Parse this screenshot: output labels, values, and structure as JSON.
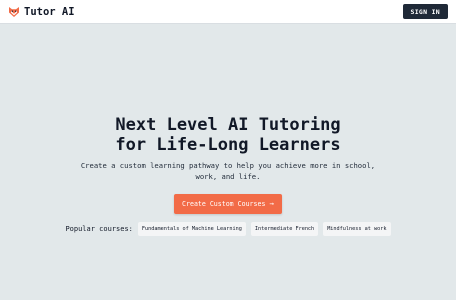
{
  "navbar": {
    "brand_name": "Tutor AI",
    "signin_label": "SIGN IN"
  },
  "hero": {
    "headline_line1": "Next Level AI Tutoring",
    "headline_line2": "for Life-Long Learners",
    "subtext": "Create a custom learning pathway to help you achieve more in school, work, and life.",
    "cta_label": "Create Custom Courses",
    "cta_icon": "→"
  },
  "popular": {
    "label": "Popular courses:",
    "courses": [
      "Fundamentals of Machine Learning",
      "Intermediate French",
      "Mindfulness at work"
    ]
  },
  "colors": {
    "background": "#e2e8ea",
    "accent": "#f26b47",
    "signin_bg": "#1f2937"
  }
}
